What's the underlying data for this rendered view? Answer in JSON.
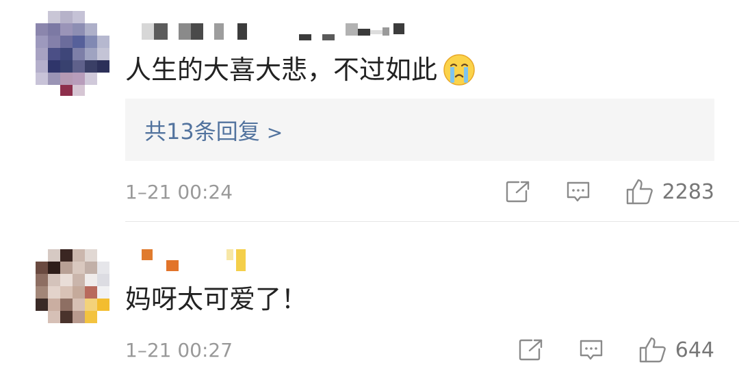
{
  "comments": [
    {
      "text": "人生的大喜大悲，不过如此",
      "emoji": "crying-face-icon",
      "replies_label": "共13条回复",
      "replies_arrow": ">",
      "timestamp": "1–21 00:24",
      "like_count": "2283"
    },
    {
      "text": "妈呀太可爱了！",
      "timestamp": "1–21 00:27",
      "like_count": "644"
    }
  ],
  "colors": {
    "link": "#52739e",
    "meta_text": "#999999",
    "reply_bg": "#f5f5f5"
  }
}
